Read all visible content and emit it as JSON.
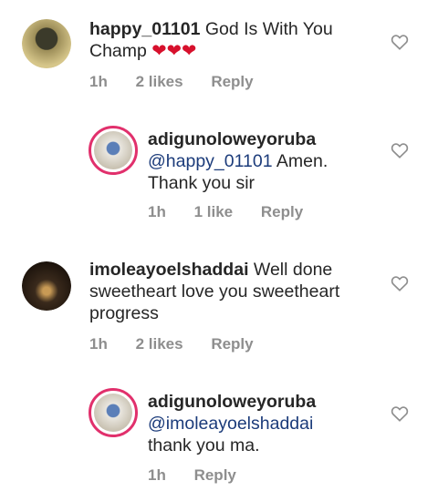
{
  "comments": [
    {
      "username": "happy_01101",
      "text": "God Is With You Champ",
      "emoji": "❤❤❤",
      "time": "1h",
      "likes": "2 likes",
      "reply": "Reply"
    },
    {
      "username": "adigunoloweyoruba",
      "mention": "@happy_01101",
      "text": " Amen. Thank you sir",
      "time": "1h",
      "likes": "1 like",
      "reply": "Reply"
    },
    {
      "username": "imoleayoelshaddai",
      "text": "Well done sweetheart love you sweetheart progress",
      "time": "1h",
      "likes": "2 likes",
      "reply": "Reply"
    },
    {
      "username": "adigunoloweyoruba",
      "mention": "@imoleayoelshaddai",
      "text": " thank you ma.",
      "time": "1h",
      "reply": "Reply"
    }
  ],
  "icons": {
    "like": "heart-outline-icon"
  },
  "colors": {
    "story_ring": "#e1306c",
    "mention": "#1b3b7a",
    "meta": "#8e8e8e"
  }
}
